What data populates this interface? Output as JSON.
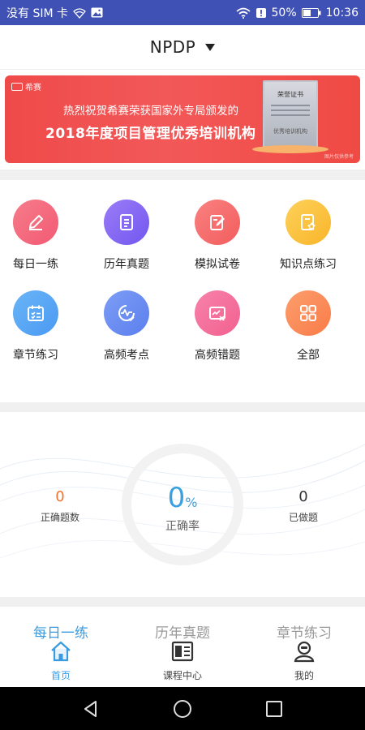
{
  "status_bar": {
    "sim_text": "没有 SIM 卡",
    "battery": "50%",
    "time": "10:36",
    "background": "#3f51b5"
  },
  "header": {
    "title": "NPDP"
  },
  "banner": {
    "logo_text": "希赛",
    "subtitle": "热烈祝贺希赛荣获国家外专局颁发的",
    "title": "2018年度项目管理优秀培训机构",
    "cert_title": "荣誉证书",
    "cert_name": "优秀培训机构",
    "footnote": "图片仅供参考"
  },
  "grid": {
    "items": [
      {
        "label": "每日一练",
        "icon": "pencil-icon",
        "color": "#f46b7e"
      },
      {
        "label": "历年真题",
        "icon": "clipboard-icon",
        "color": "#8a6ef5"
      },
      {
        "label": "模拟试卷",
        "icon": "edit-paper-icon",
        "color": "#f76f6f"
      },
      {
        "label": "知识点练习",
        "icon": "star-doc-icon",
        "color": "#fcc33c"
      },
      {
        "label": "章节练习",
        "icon": "checklist-icon",
        "color": "#5aa9f7"
      },
      {
        "label": "高频考点",
        "icon": "pulse-check-icon",
        "color": "#6b8ef2"
      },
      {
        "label": "高频错题",
        "icon": "wrong-chart-icon",
        "color": "#f46f9c"
      },
      {
        "label": "全部",
        "icon": "grid-icon",
        "color": "#fb8a5a"
      }
    ]
  },
  "stats": {
    "correct_count": "0",
    "correct_count_label": "正确题数",
    "accuracy": "0",
    "accuracy_unit": "%",
    "accuracy_label": "正确率",
    "done_count": "0",
    "done_count_label": "已做题",
    "accent": "#3aa0df",
    "orange": "#f0722e"
  },
  "section_tabs": [
    {
      "label": "每日一练",
      "active": true
    },
    {
      "label": "历年真题",
      "active": false
    },
    {
      "label": "章节练习",
      "active": false
    }
  ],
  "bottom_nav": [
    {
      "label": "首页",
      "icon": "home-icon",
      "active": true
    },
    {
      "label": "课程中心",
      "icon": "course-icon",
      "active": false
    },
    {
      "label": "我的",
      "icon": "profile-icon",
      "active": false
    }
  ]
}
